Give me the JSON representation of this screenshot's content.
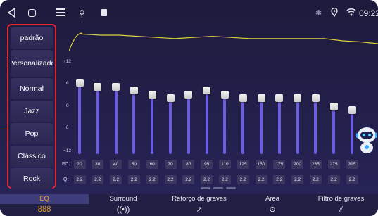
{
  "status_bar": {
    "time": "09:22",
    "icons": [
      "back-icon",
      "home-icon",
      "menu-icon",
      "usb-icon",
      "sd-card-icon",
      "bluetooth-icon",
      "location-icon",
      "wifi-icon"
    ]
  },
  "presets": [
    "padrão",
    "Personalizado",
    "Normal",
    "Jazz",
    "Pop",
    "Clássico",
    "Rock"
  ],
  "eq": {
    "scale": [
      "+12",
      "6",
      "0",
      "−6",
      "−12"
    ],
    "fc_label": "FC:",
    "q_label": "Q:",
    "bands": [
      {
        "fc": "20",
        "q": "2.2",
        "gain": 6
      },
      {
        "fc": "30",
        "q": "2.2",
        "gain": 5
      },
      {
        "fc": "40",
        "q": "2.2",
        "gain": 5
      },
      {
        "fc": "50",
        "q": "2.2",
        "gain": 4
      },
      {
        "fc": "60",
        "q": "2.2",
        "gain": 3
      },
      {
        "fc": "70",
        "q": "2.2",
        "gain": 2
      },
      {
        "fc": "80",
        "q": "2.2",
        "gain": 3
      },
      {
        "fc": "95",
        "q": "2.2",
        "gain": 4
      },
      {
        "fc": "110",
        "q": "2.2",
        "gain": 3
      },
      {
        "fc": "125",
        "q": "2.2",
        "gain": 2
      },
      {
        "fc": "150",
        "q": "2.2",
        "gain": 2
      },
      {
        "fc": "175",
        "q": "2.2",
        "gain": 2
      },
      {
        "fc": "200",
        "q": "2.2",
        "gain": 2
      },
      {
        "fc": "235",
        "q": "2.2",
        "gain": 2
      },
      {
        "fc": "275",
        "q": "2.2",
        "gain": 0
      },
      {
        "fc": "315",
        "q": "2.2",
        "gain": -1
      }
    ],
    "gain_range": [
      -12,
      12
    ]
  },
  "tabs": [
    {
      "label": "EQ",
      "icon": "equalizer-icon",
      "active": true
    },
    {
      "label": "Surround",
      "icon": "surround-icon",
      "active": false
    },
    {
      "label": "Reforço de graves",
      "icon": "bass-boost-icon",
      "active": false
    },
    {
      "label": "Area",
      "icon": "area-icon",
      "active": false
    },
    {
      "label": "Filtro de graves",
      "icon": "bass-filter-icon",
      "active": false
    }
  ],
  "colors": {
    "accent": "#f0a020",
    "slider": "#6c5de0",
    "highlight_border": "#e0262a",
    "curve": "#e0d040"
  }
}
